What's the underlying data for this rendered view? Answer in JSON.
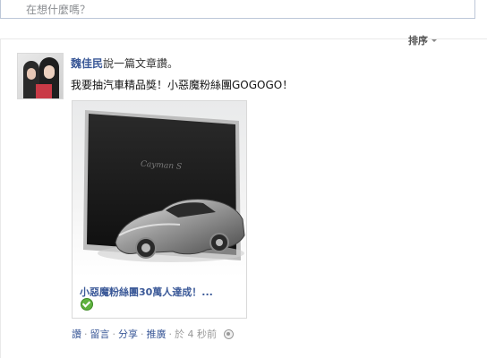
{
  "composer": {
    "placeholder": "在想什麼嗎？"
  },
  "feed": {
    "sort_label": "排序"
  },
  "story": {
    "actor_name": "魏佳民",
    "verb_text": "說一篇文章讚。",
    "message": "我要抽汽車精品獎！小惡魔粉絲團GOGOGO！",
    "attachment": {
      "title": "小惡魔粉絲團30萬人達成！...",
      "image_brand_text": "Cayman S"
    },
    "actions": {
      "like": "讚",
      "comment": "留言",
      "share": "分享",
      "recommend": "推廣",
      "timestamp": "於 4 秒前"
    }
  }
}
